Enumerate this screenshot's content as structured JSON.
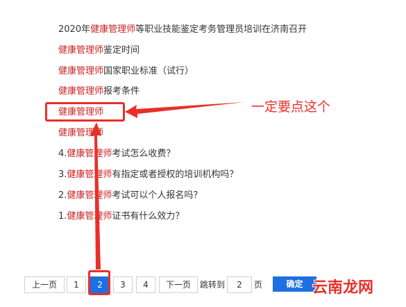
{
  "results": [
    {
      "pre": "2020年",
      "hl": "健康管理师",
      "post": "等职业技能鉴定考务管理员培训在济南召开"
    },
    {
      "pre": "",
      "hl": "健康管理师",
      "post": "鉴定时间"
    },
    {
      "pre": "",
      "hl": "健康管理师",
      "post": "国家职业标准（试行）"
    },
    {
      "pre": "",
      "hl": "健康管理师",
      "post": "报考条件"
    },
    {
      "pre": "",
      "hl": "健康管理师",
      "post": ""
    },
    {
      "pre": "",
      "hl": "健康管理师",
      "post": ""
    },
    {
      "pre": "4.",
      "hl": "健康管理师",
      "post": "考试怎么收费？"
    },
    {
      "pre": "3.",
      "hl": "健康管理师",
      "post": "有指定或者授权的培训机构吗？"
    },
    {
      "pre": "2.",
      "hl": "健康管理师",
      "post": "考试可以个人报名吗？"
    },
    {
      "pre": "1.",
      "hl": "健康管理师",
      "post": "证书有什么效力？"
    }
  ],
  "annotation": "一定要点这个",
  "pagination": {
    "prev": "上一页",
    "pages": [
      "1",
      "2",
      "3",
      "4"
    ],
    "current": "2",
    "next": "下一页",
    "jump_label": "跳转到",
    "jump_value": "2",
    "page_suffix": "页",
    "confirm": "确定"
  },
  "watermark": "云南龙网",
  "colors": {
    "highlight": "#cc2222",
    "annotation": "#e8302a",
    "accent": "#1e70e0"
  }
}
